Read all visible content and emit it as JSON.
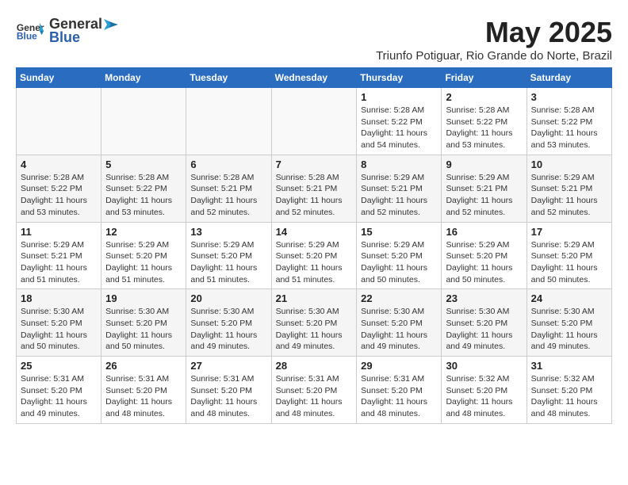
{
  "logo": {
    "general": "General",
    "blue": "Blue"
  },
  "title": "May 2025",
  "subtitle": "Triunfo Potiguar, Rio Grande do Norte, Brazil",
  "weekdays": [
    "Sunday",
    "Monday",
    "Tuesday",
    "Wednesday",
    "Thursday",
    "Friday",
    "Saturday"
  ],
  "weeks": [
    [
      {
        "day": "",
        "info": ""
      },
      {
        "day": "",
        "info": ""
      },
      {
        "day": "",
        "info": ""
      },
      {
        "day": "",
        "info": ""
      },
      {
        "day": "1",
        "sunrise": "5:28 AM",
        "sunset": "5:22 PM",
        "daylight": "11 hours and 54 minutes."
      },
      {
        "day": "2",
        "sunrise": "5:28 AM",
        "sunset": "5:22 PM",
        "daylight": "11 hours and 53 minutes."
      },
      {
        "day": "3",
        "sunrise": "5:28 AM",
        "sunset": "5:22 PM",
        "daylight": "11 hours and 53 minutes."
      }
    ],
    [
      {
        "day": "4",
        "sunrise": "5:28 AM",
        "sunset": "5:22 PM",
        "daylight": "11 hours and 53 minutes."
      },
      {
        "day": "5",
        "sunrise": "5:28 AM",
        "sunset": "5:22 PM",
        "daylight": "11 hours and 53 minutes."
      },
      {
        "day": "6",
        "sunrise": "5:28 AM",
        "sunset": "5:21 PM",
        "daylight": "11 hours and 52 minutes."
      },
      {
        "day": "7",
        "sunrise": "5:28 AM",
        "sunset": "5:21 PM",
        "daylight": "11 hours and 52 minutes."
      },
      {
        "day": "8",
        "sunrise": "5:29 AM",
        "sunset": "5:21 PM",
        "daylight": "11 hours and 52 minutes."
      },
      {
        "day": "9",
        "sunrise": "5:29 AM",
        "sunset": "5:21 PM",
        "daylight": "11 hours and 52 minutes."
      },
      {
        "day": "10",
        "sunrise": "5:29 AM",
        "sunset": "5:21 PM",
        "daylight": "11 hours and 52 minutes."
      }
    ],
    [
      {
        "day": "11",
        "sunrise": "5:29 AM",
        "sunset": "5:21 PM",
        "daylight": "11 hours and 51 minutes."
      },
      {
        "day": "12",
        "sunrise": "5:29 AM",
        "sunset": "5:20 PM",
        "daylight": "11 hours and 51 minutes."
      },
      {
        "day": "13",
        "sunrise": "5:29 AM",
        "sunset": "5:20 PM",
        "daylight": "11 hours and 51 minutes."
      },
      {
        "day": "14",
        "sunrise": "5:29 AM",
        "sunset": "5:20 PM",
        "daylight": "11 hours and 51 minutes."
      },
      {
        "day": "15",
        "sunrise": "5:29 AM",
        "sunset": "5:20 PM",
        "daylight": "11 hours and 50 minutes."
      },
      {
        "day": "16",
        "sunrise": "5:29 AM",
        "sunset": "5:20 PM",
        "daylight": "11 hours and 50 minutes."
      },
      {
        "day": "17",
        "sunrise": "5:29 AM",
        "sunset": "5:20 PM",
        "daylight": "11 hours and 50 minutes."
      }
    ],
    [
      {
        "day": "18",
        "sunrise": "5:30 AM",
        "sunset": "5:20 PM",
        "daylight": "11 hours and 50 minutes."
      },
      {
        "day": "19",
        "sunrise": "5:30 AM",
        "sunset": "5:20 PM",
        "daylight": "11 hours and 50 minutes."
      },
      {
        "day": "20",
        "sunrise": "5:30 AM",
        "sunset": "5:20 PM",
        "daylight": "11 hours and 49 minutes."
      },
      {
        "day": "21",
        "sunrise": "5:30 AM",
        "sunset": "5:20 PM",
        "daylight": "11 hours and 49 minutes."
      },
      {
        "day": "22",
        "sunrise": "5:30 AM",
        "sunset": "5:20 PM",
        "daylight": "11 hours and 49 minutes."
      },
      {
        "day": "23",
        "sunrise": "5:30 AM",
        "sunset": "5:20 PM",
        "daylight": "11 hours and 49 minutes."
      },
      {
        "day": "24",
        "sunrise": "5:30 AM",
        "sunset": "5:20 PM",
        "daylight": "11 hours and 49 minutes."
      }
    ],
    [
      {
        "day": "25",
        "sunrise": "5:31 AM",
        "sunset": "5:20 PM",
        "daylight": "11 hours and 49 minutes."
      },
      {
        "day": "26",
        "sunrise": "5:31 AM",
        "sunset": "5:20 PM",
        "daylight": "11 hours and 48 minutes."
      },
      {
        "day": "27",
        "sunrise": "5:31 AM",
        "sunset": "5:20 PM",
        "daylight": "11 hours and 48 minutes."
      },
      {
        "day": "28",
        "sunrise": "5:31 AM",
        "sunset": "5:20 PM",
        "daylight": "11 hours and 48 minutes."
      },
      {
        "day": "29",
        "sunrise": "5:31 AM",
        "sunset": "5:20 PM",
        "daylight": "11 hours and 48 minutes."
      },
      {
        "day": "30",
        "sunrise": "5:32 AM",
        "sunset": "5:20 PM",
        "daylight": "11 hours and 48 minutes."
      },
      {
        "day": "31",
        "sunrise": "5:32 AM",
        "sunset": "5:20 PM",
        "daylight": "11 hours and 48 minutes."
      }
    ]
  ]
}
